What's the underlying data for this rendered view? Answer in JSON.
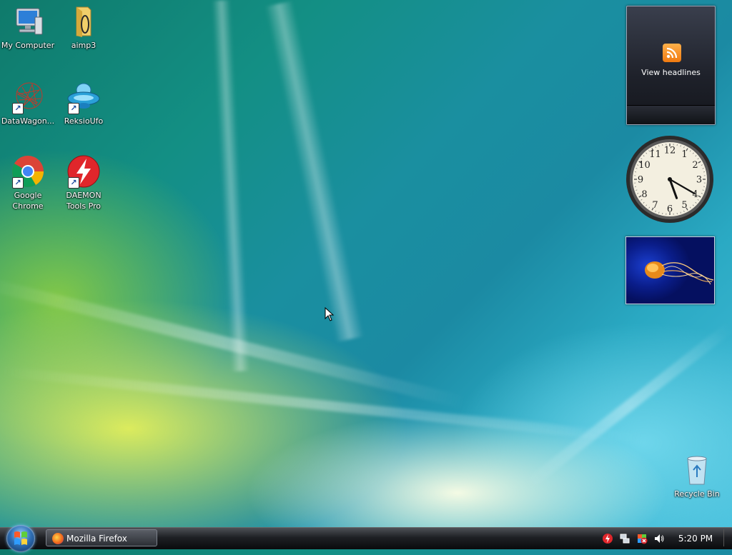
{
  "desktop": {
    "icons": [
      {
        "label": "My Computer"
      },
      {
        "label": "aimp3"
      },
      {
        "label": "DataWagon..."
      },
      {
        "label": "ReksioUfo"
      },
      {
        "label": "Google Chrome"
      },
      {
        "label": "DAEMON Tools Pro"
      },
      {
        "label": "Recycle Bin"
      }
    ]
  },
  "sidebar": {
    "feed_gadget": {
      "caption": "View headlines",
      "icon": "rss-icon"
    },
    "clock_gadget": {
      "numerals": [
        "12",
        "1",
        "2",
        "3",
        "4",
        "5",
        "6",
        "7",
        "8",
        "9",
        "10",
        "11"
      ],
      "time": "5:20"
    },
    "slideshow_gadget": {
      "image": "jellyfish"
    }
  },
  "taskbar": {
    "start_icon": "windows-logo-icon",
    "tasks": [
      {
        "label": "Mozilla Firefox",
        "icon": "firefox-icon"
      }
    ],
    "tray_icons": [
      "daemon-tools-icon",
      "network-icon",
      "security-alert-icon",
      "volume-icon"
    ],
    "clock": "5:20 PM"
  },
  "colors": {
    "accent": "#1b8aa3",
    "taskbar": "#1e2024",
    "rss": "#f07a10"
  }
}
